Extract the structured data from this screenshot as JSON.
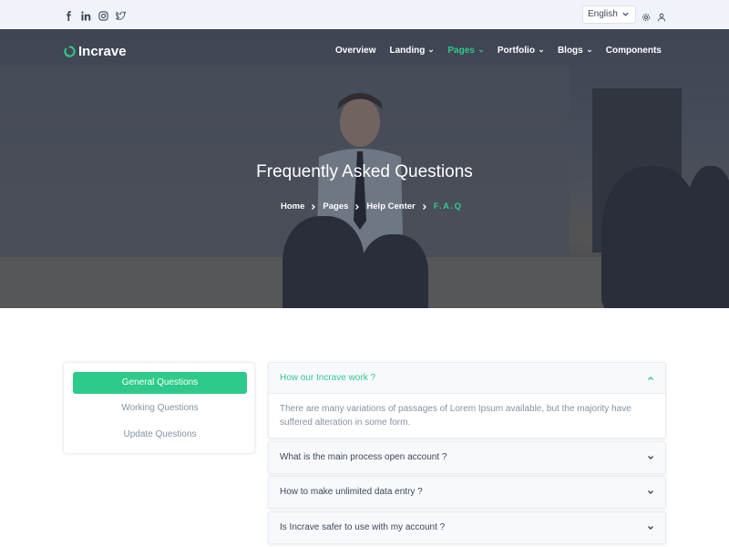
{
  "topbar": {
    "social_icons": [
      "facebook-icon",
      "linkedin-icon",
      "instagram-icon",
      "twitter-icon"
    ],
    "language": "English",
    "icons": [
      "settings-icon",
      "user-icon"
    ]
  },
  "brand": {
    "name": "Incrave",
    "accent_color": "#2eca8b"
  },
  "nav": {
    "items": [
      {
        "label": "Overview",
        "has_dropdown": false,
        "active": false
      },
      {
        "label": "Landing",
        "has_dropdown": true,
        "active": false
      },
      {
        "label": "Pages",
        "has_dropdown": true,
        "active": true
      },
      {
        "label": "Portfolio",
        "has_dropdown": true,
        "active": false
      },
      {
        "label": "Blogs",
        "has_dropdown": true,
        "active": false
      },
      {
        "label": "Components",
        "has_dropdown": false,
        "active": false
      }
    ]
  },
  "hero": {
    "title": "Frequently Asked Questions",
    "breadcrumbs": [
      "Home",
      "Pages",
      "Help Center",
      "F.A.Q"
    ]
  },
  "sidebar": {
    "items": [
      {
        "label": "General Questions",
        "active": true
      },
      {
        "label": "Working Questions",
        "active": false
      },
      {
        "label": "Update Questions",
        "active": false
      }
    ]
  },
  "faq": {
    "items": [
      {
        "question": "How our Incrave work ?",
        "open": true,
        "answer": "There are many variations of passages of Lorem Ipsum available, but the majority have suffered alteration in some form."
      },
      {
        "question": "What is the main process open account ?",
        "open": false
      },
      {
        "question": "How to make unlimited data entry ?",
        "open": false
      },
      {
        "question": "Is Incrave safer to use with my account ?",
        "open": false
      }
    ]
  }
}
